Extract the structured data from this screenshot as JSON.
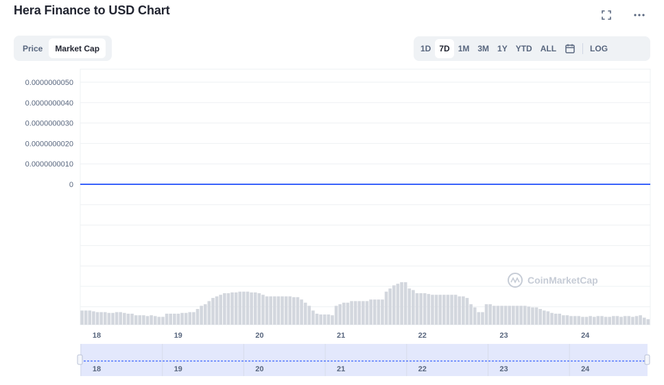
{
  "header": {
    "title": "Hera Finance to USD Chart",
    "fullscreen_icon": "fullscreen-icon",
    "more_icon": "more-horizontal-icon"
  },
  "view_toggle": {
    "options": [
      "Price",
      "Market Cap"
    ],
    "selected": "Market Cap"
  },
  "range_selector": {
    "options": [
      "1D",
      "7D",
      "1M",
      "3M",
      "1Y",
      "YTD",
      "ALL"
    ],
    "selected": "7D",
    "calendar_icon": "calendar-icon",
    "log_label": "LOG"
  },
  "watermark": {
    "text": "CoinMarketCap",
    "icon": "coinmarketcap-logo-icon"
  },
  "colors": {
    "line": "#3861fb",
    "volume_bars": "#d3d7de",
    "navigator_fill": "#e3e8fc",
    "grid": "#eef0f3"
  },
  "chart_data": {
    "type": "line",
    "title": "Hera Finance to USD Chart",
    "y_tick_labels": [
      "0.0000000050",
      "0.0000000040",
      "0.0000000030",
      "0.0000000020",
      "0.0000000010",
      "0"
    ],
    "ylim": [
      0,
      5e-09
    ],
    "x_tick_labels": [
      "18",
      "19",
      "20",
      "21",
      "22",
      "23",
      "24"
    ],
    "navigator_tick_labels": [
      "18",
      "19",
      "20",
      "21",
      "22",
      "23",
      "24"
    ],
    "series": [
      {
        "values": [
          0,
          0,
          0,
          0,
          0,
          0,
          0,
          0
        ]
      }
    ],
    "volume": {
      "x_range": [
        17.8,
        24.8
      ],
      "values": [
        18,
        18,
        18,
        17,
        16,
        16,
        16,
        15,
        15,
        16,
        16,
        15,
        14,
        14,
        12,
        12,
        12,
        11,
        12,
        11,
        10,
        10,
        14,
        14,
        14,
        14,
        15,
        15,
        16,
        16,
        20,
        24,
        26,
        30,
        34,
        36,
        38,
        40,
        40,
        41,
        41,
        42,
        42,
        42,
        41,
        41,
        40,
        38,
        36,
        36,
        36,
        36,
        36,
        36,
        36,
        35,
        35,
        32,
        28,
        24,
        18,
        14,
        13,
        13,
        13,
        12,
        24,
        26,
        28,
        28,
        30,
        30,
        30,
        30,
        30,
        32,
        32,
        32,
        32,
        42,
        46,
        50,
        52,
        54,
        54,
        46,
        44,
        40,
        40,
        40,
        39,
        38,
        38,
        38,
        38,
        38,
        38,
        38,
        36,
        36,
        34,
        26,
        22,
        16,
        16,
        26,
        26,
        24,
        24,
        24,
        24,
        24,
        24,
        24,
        24,
        24,
        23,
        22,
        22,
        20,
        18,
        17,
        15,
        14,
        14,
        12,
        12,
        11,
        11,
        11,
        10,
        10,
        11,
        10,
        11,
        11,
        10,
        10,
        11,
        11,
        10,
        11,
        11,
        10,
        11,
        12,
        9,
        7
      ],
      "unit": "relative"
    },
    "grid": true,
    "legend": "none"
  }
}
